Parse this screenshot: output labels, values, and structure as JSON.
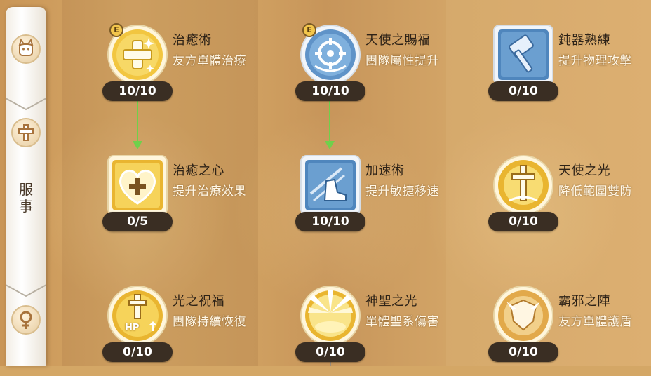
{
  "sidebar": {
    "tabs": [
      {
        "icon": "cat-icon"
      },
      {
        "icon": "cross-icon"
      },
      {
        "icon": "female-symbol-icon"
      }
    ],
    "label": "服事"
  },
  "colors": {
    "level_badge_bg": "#3a2e23",
    "unlock_arrow": "#6fd04b",
    "holy_gold": "#f2c640",
    "blue_skill": "#5f93c8"
  },
  "skills": [
    {
      "name": "治癒術",
      "desc": "友方單體治療",
      "level": "10/10",
      "badge": "E",
      "icon": "healing-sparkle-icon"
    },
    {
      "name": "天使之賜福",
      "desc": "團隊屬性提升",
      "level": "10/10",
      "badge": "E",
      "icon": "angel-blessing-icon"
    },
    {
      "name": "鈍器熟練",
      "desc": "提升物理攻擊",
      "level": "0/10",
      "icon": "mace-icon"
    },
    {
      "name": "治癒之心",
      "desc": "提升治療效果",
      "level": "0/5",
      "icon": "heart-plus-icon"
    },
    {
      "name": "加速術",
      "desc": "提升敏捷移速",
      "level": "10/10",
      "icon": "winged-boot-icon"
    },
    {
      "name": "天使之光",
      "desc": "降低範圍雙防",
      "level": "0/10",
      "icon": "holy-cross-icon"
    },
    {
      "name": "光之祝福",
      "desc": "團隊持續恢復",
      "level": "0/10",
      "icon": "hp-regen-cross-icon",
      "icon_text": "HP"
    },
    {
      "name": "神聖之光",
      "desc": "單體聖系傷害",
      "level": "0/10",
      "icon": "holy-light-rays-icon"
    },
    {
      "name": "霸邪之陣",
      "desc": "友方單體護盾",
      "level": "0/10",
      "icon": "shield-burst-icon"
    }
  ]
}
